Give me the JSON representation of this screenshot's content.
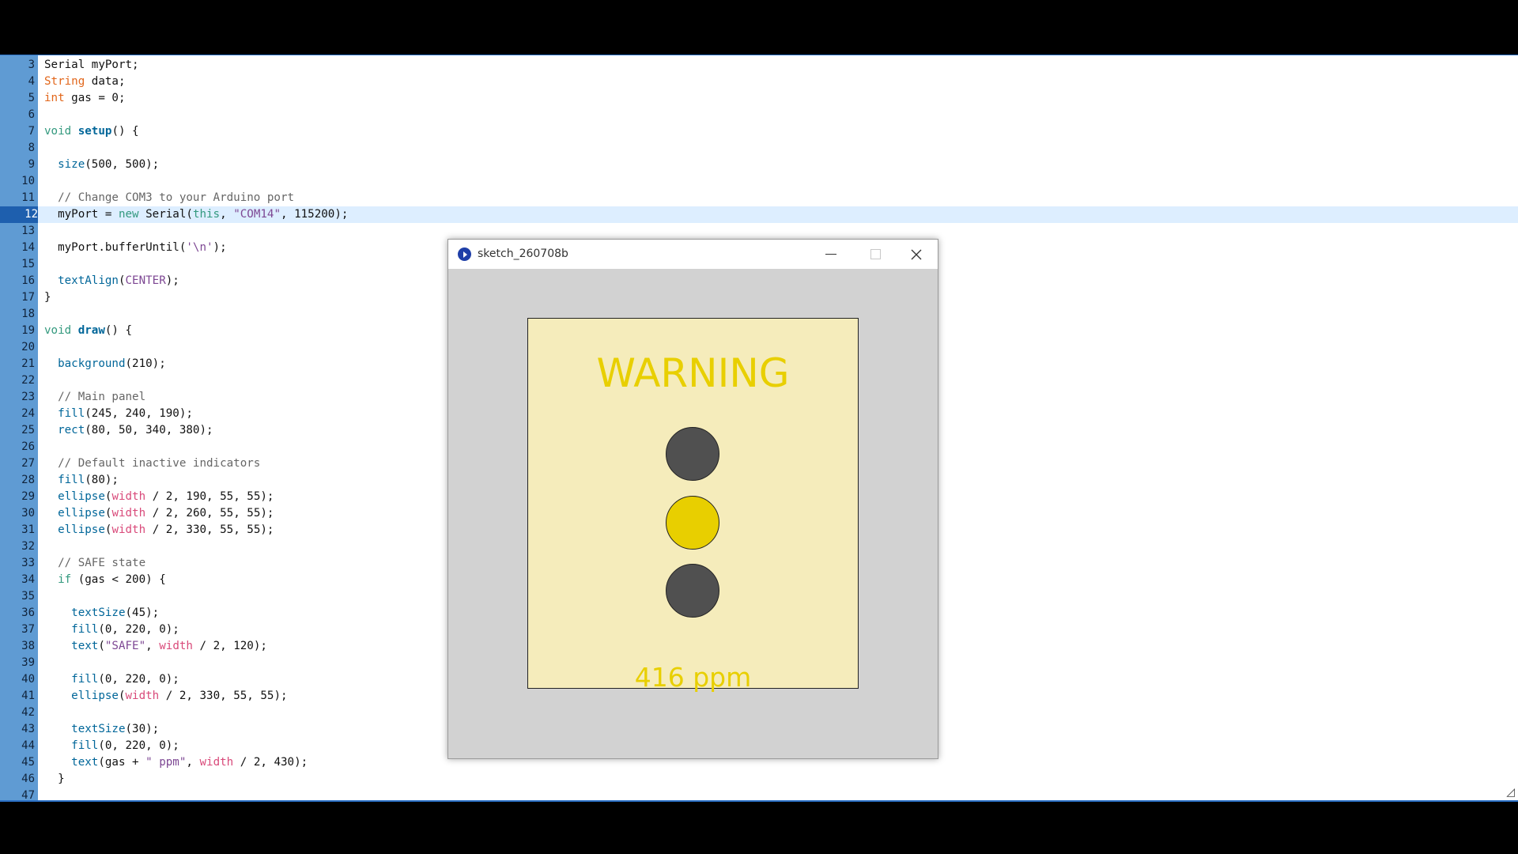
{
  "editor": {
    "active_line": 12,
    "lines": [
      {
        "n": "3",
        "html": "Serial myPort;"
      },
      {
        "n": "4",
        "html": "<span class='kw-type'>String</span> data;"
      },
      {
        "n": "5",
        "html": "<span class='kw-type'>int</span> gas = 0;"
      },
      {
        "n": "6",
        "html": ""
      },
      {
        "n": "7",
        "html": "<span class='kw'>void</span> <span class='fn-def'>setup</span>() {"
      },
      {
        "n": "8",
        "html": ""
      },
      {
        "n": "9",
        "html": "  <span class='fn'>size</span>(500, 500);"
      },
      {
        "n": "10",
        "html": ""
      },
      {
        "n": "11",
        "html": "  <span class='cmt'>// Change COM3 to your Arduino port</span>"
      },
      {
        "n": "12",
        "html": "  myPort = <span class='kw'>new</span> Serial(<span class='kw'>this</span>, <span class='str'>\"COM14\"</span>, 115200);"
      },
      {
        "n": "13",
        "html": ""
      },
      {
        "n": "14",
        "html": "  myPort.bufferUntil(<span class='str'>'\\n'</span>);"
      },
      {
        "n": "15",
        "html": ""
      },
      {
        "n": "16",
        "html": "  <span class='fn'>textAlign</span>(<span class='str'>CENTER</span>);"
      },
      {
        "n": "17",
        "html": "}"
      },
      {
        "n": "18",
        "html": ""
      },
      {
        "n": "19",
        "html": "<span class='kw'>void</span> <span class='fn-def'>draw</span>() {"
      },
      {
        "n": "20",
        "html": ""
      },
      {
        "n": "21",
        "html": "  <span class='fn'>background</span>(210);"
      },
      {
        "n": "22",
        "html": ""
      },
      {
        "n": "23",
        "html": "  <span class='cmt'>// Main panel</span>"
      },
      {
        "n": "24",
        "html": "  <span class='fn'>fill</span>(245, 240, 190);"
      },
      {
        "n": "25",
        "html": "  <span class='fn'>rect</span>(80, 50, 340, 380);"
      },
      {
        "n": "26",
        "html": ""
      },
      {
        "n": "27",
        "html": "  <span class='cmt'>// Default inactive indicators</span>"
      },
      {
        "n": "28",
        "html": "  <span class='fn'>fill</span>(80);"
      },
      {
        "n": "29",
        "html": "  <span class='fn'>ellipse</span>(<span class='const'>width</span> / 2, 190, 55, 55);"
      },
      {
        "n": "30",
        "html": "  <span class='fn'>ellipse</span>(<span class='const'>width</span> / 2, 260, 55, 55);"
      },
      {
        "n": "31",
        "html": "  <span class='fn'>ellipse</span>(<span class='const'>width</span> / 2, 330, 55, 55);"
      },
      {
        "n": "32",
        "html": ""
      },
      {
        "n": "33",
        "html": "  <span class='cmt'>// SAFE state</span>"
      },
      {
        "n": "34",
        "html": "  <span class='kw'>if</span> (gas &lt; 200) {"
      },
      {
        "n": "35",
        "html": ""
      },
      {
        "n": "36",
        "html": "    <span class='fn'>textSize</span>(45);"
      },
      {
        "n": "37",
        "html": "    <span class='fn'>fill</span>(0, 220, 0);"
      },
      {
        "n": "38",
        "html": "    <span class='fn'>text</span>(<span class='str'>\"SAFE\"</span>, <span class='const'>width</span> / 2, 120);"
      },
      {
        "n": "39",
        "html": ""
      },
      {
        "n": "40",
        "html": "    <span class='fn'>fill</span>(0, 220, 0);"
      },
      {
        "n": "41",
        "html": "    <span class='fn'>ellipse</span>(<span class='const'>width</span> / 2, 330, 55, 55);"
      },
      {
        "n": "42",
        "html": ""
      },
      {
        "n": "43",
        "html": "    <span class='fn'>textSize</span>(30);"
      },
      {
        "n": "44",
        "html": "    <span class='fn'>fill</span>(0, 220, 0);"
      },
      {
        "n": "45",
        "html": "    <span class='fn'>text</span>(gas + <span class='str'>\" ppm\"</span>, <span class='const'>width</span> / 2, 430);"
      },
      {
        "n": "46",
        "html": "  }"
      },
      {
        "n": "47",
        "html": ""
      }
    ]
  },
  "sketch_window": {
    "title": "sketch_260708b",
    "state_label": "WARNING",
    "reading": "416 ppm",
    "indicators": [
      {
        "name": "top",
        "color": "#505050"
      },
      {
        "name": "middle",
        "color": "#e8cf00"
      },
      {
        "name": "bottom",
        "color": "#505050"
      }
    ]
  }
}
